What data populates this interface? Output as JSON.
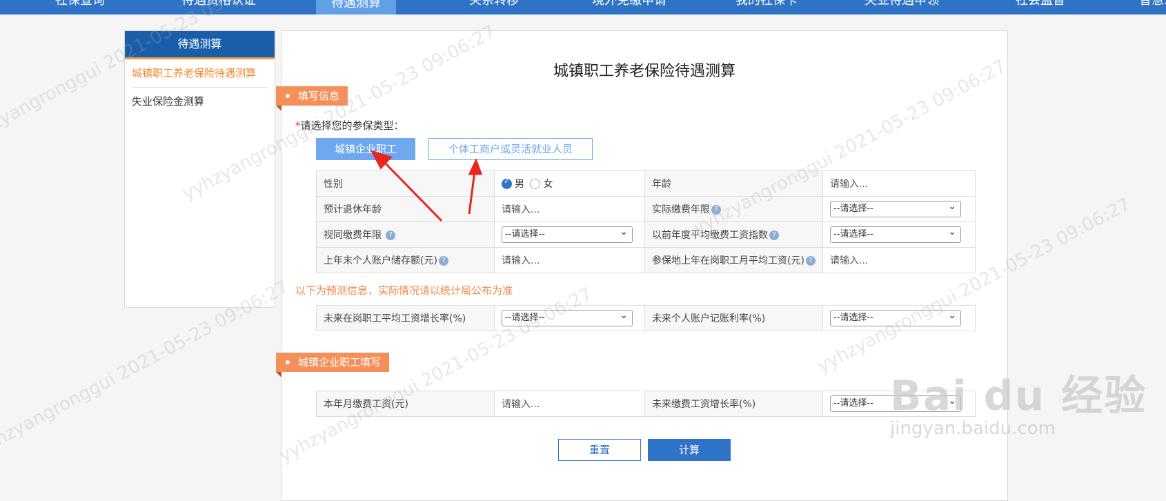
{
  "topnav": {
    "items": [
      "社保查询",
      "待遇资格认证",
      "待遇测算",
      "关系转移",
      "境外免缴申请",
      "我的社保卡",
      "失业待遇申领",
      "社会监督",
      "智慧..."
    ]
  },
  "sidebar": {
    "header": "待遇测算",
    "links": [
      "城镇职工养老保险待遇测算",
      "失业保险金测算"
    ]
  },
  "main": {
    "title": "城镇职工养老保险待遇测算",
    "section1": "填写信息",
    "prompt_required": "*",
    "prompt": "请选择您的参保类型：",
    "type_selected": "城镇企业职工",
    "type_other": "个体工商户或灵活就业人员",
    "form": {
      "gender_label": "性别",
      "gender_male": "男",
      "gender_female": "女",
      "age_label": "年龄",
      "age_placeholder": "请输入...",
      "retire_age_label": "预计退休年龄",
      "retire_age_placeholder": "请输入...",
      "actual_years_label": "实际缴费年限",
      "actual_years_value": "--请选择--",
      "deemed_years_label": "视同缴费年限",
      "deemed_years_value": "--请选择--",
      "avg_index_label": "以前年度平均缴费工资指数",
      "avg_index_value": "--请选择--",
      "account_balance_label": "上年末个人账户储存额(元)",
      "account_balance_placeholder": "请输入...",
      "avg_wage_label": "参保地上年在岗职工月平均工资(元)",
      "avg_wage_placeholder": "请输入..."
    },
    "note": "以下为预测信息，实际情况请以统计局公布为准",
    "forecast": {
      "wage_growth_label": "未来在岗职工平均工资增长率(%)",
      "wage_growth_value": "--请选择--",
      "interest_label": "未来个人账户记账利率(%)",
      "interest_value": "--请选择--"
    },
    "section2": "城镇企业职工填写",
    "employee": {
      "monthly_wage_label": "本年月缴费工资(元)",
      "monthly_wage_placeholder": "请输入...",
      "wage_growth_label": "未来缴费工资增长率(%)",
      "wage_growth_value": "--请选择--"
    },
    "reset_label": "重置",
    "calc_label": "计算"
  },
  "watermark": {
    "text": "yyhzyangronggui 2021-05-23 09:06:27",
    "brand": "Bai du 经验",
    "url": "jingyan.baidu.com"
  },
  "colors": {
    "nav": "#2f73c7",
    "accent": "#f5905a",
    "button_primary": "#2f73c7",
    "type_selected": "#6fa8ef"
  }
}
